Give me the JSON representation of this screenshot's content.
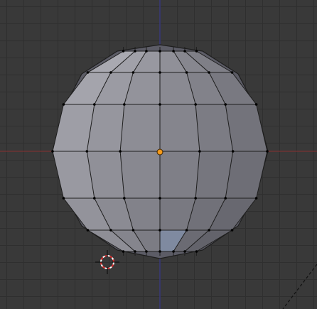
{
  "viewport": {
    "view": "front-orthographic",
    "background_color": "#393939",
    "grid_color": "#2f2f2f",
    "x_axis_color": "#7a3232",
    "z_axis_color": "#3a3a86"
  },
  "mesh": {
    "type": "uv-sphere",
    "face_light": "#a3a3a3",
    "face_dark": "#4a4a55",
    "edge_color": "#1e1e1e",
    "vertex_color": "#000000",
    "selected_face_color": "#7f8aa0"
  },
  "origin": {
    "color": "#f59a1a"
  },
  "cursor_3d": {
    "icon": "crosshair-cursor-icon",
    "ring_color": "#d93030"
  }
}
